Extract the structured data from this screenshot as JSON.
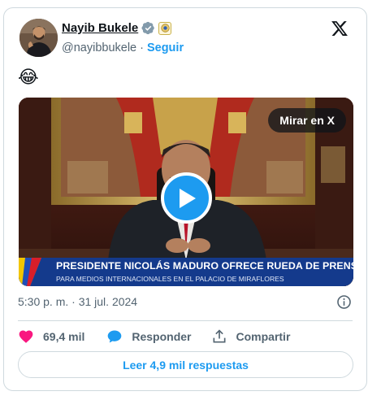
{
  "author": {
    "name": "Nayib Bukele",
    "handle": "@nayibbukele",
    "separator": "·",
    "follow_label": "Seguir"
  },
  "icons": {
    "verified": "verified-badge-icon",
    "affiliation": "government-affiliation-badge-icon",
    "brand": "x-logo-icon",
    "play": "play-icon",
    "info": "info-icon",
    "like": "heart-icon",
    "reply": "speech-bubble-icon",
    "share": "share-upload-icon"
  },
  "tweet": {
    "text": "😂"
  },
  "media": {
    "watch_label": "Mirar en X",
    "banner_title": "PRESIDENTE NICOLÁS MADURO OFRECE RUEDA DE PRENSA",
    "banner_subtitle": "PARA MEDIOS INTERNACIONALES EN EL PALACIO DE MIRAFLORES"
  },
  "meta": {
    "timestamp": "5:30 p. m. · 31 jul. 2024"
  },
  "actions": {
    "likes": "69,4 mil",
    "reply_label": "Responder",
    "share_label": "Compartir"
  },
  "read_replies_label": "Leer 4,9 mil respuestas",
  "colors": {
    "accent": "#1d9bf0",
    "like": "#f91880",
    "muted": "#536471",
    "border": "#cfd9de",
    "banner": "#143a8c"
  }
}
